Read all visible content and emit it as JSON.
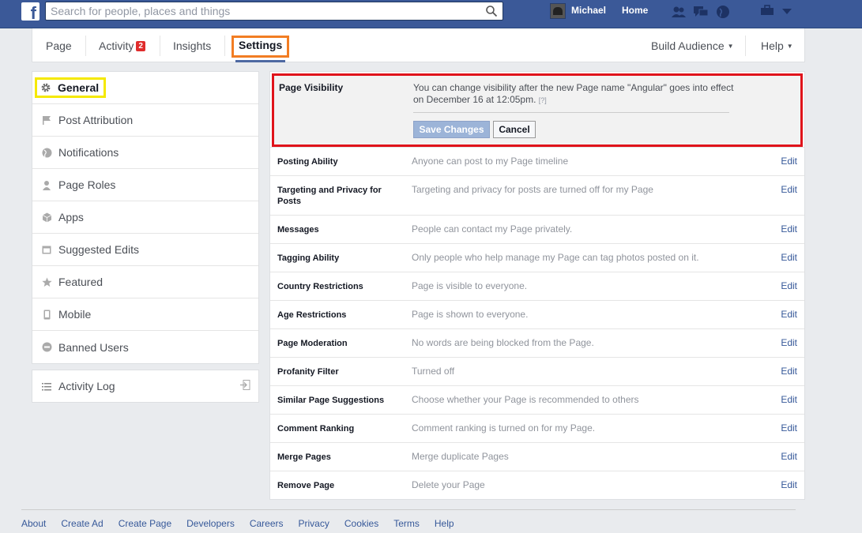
{
  "topbar": {
    "logo": "f",
    "search_placeholder": "Search for people, places and things",
    "user_name": "Michael",
    "home_label": "Home",
    "icons": [
      "friend-requests-icon",
      "messages-icon",
      "notifications-globe-icon",
      "privacy-shortcuts-icon",
      "account-caret-icon"
    ]
  },
  "pagenav": {
    "tabs": [
      {
        "label": "Page"
      },
      {
        "label": "Activity",
        "badge": "2"
      },
      {
        "label": "Insights"
      },
      {
        "label": "Settings",
        "active": true
      }
    ],
    "build_audience": "Build Audience",
    "help": "Help"
  },
  "sidebar": {
    "items": [
      {
        "label": "General",
        "icon": "gear-icon",
        "active": true
      },
      {
        "label": "Post Attribution",
        "icon": "flag-icon"
      },
      {
        "label": "Notifications",
        "icon": "globe-icon"
      },
      {
        "label": "Page Roles",
        "icon": "person-icon"
      },
      {
        "label": "Apps",
        "icon": "cube-icon"
      },
      {
        "label": "Suggested Edits",
        "icon": "calendar-icon"
      },
      {
        "label": "Featured",
        "icon": "star-icon"
      },
      {
        "label": "Mobile",
        "icon": "phone-icon"
      },
      {
        "label": "Banned Users",
        "icon": "banned-icon"
      }
    ],
    "activity_log": "Activity Log"
  },
  "visibility": {
    "label": "Page Visibility",
    "text": "You can change visibility after the new Page name \"Angular\" goes into effect on December 16 at 12:05pm.",
    "help": "[?]",
    "save": "Save Changes",
    "cancel": "Cancel"
  },
  "settings_rows": [
    {
      "label": "Posting Ability",
      "value": "Anyone can post to my Page timeline",
      "edit": "Edit"
    },
    {
      "label": "Targeting and Privacy for Posts",
      "value": "Targeting and privacy for posts are turned off for my Page",
      "edit": "Edit"
    },
    {
      "label": "Messages",
      "value": "People can contact my Page privately.",
      "edit": "Edit"
    },
    {
      "label": "Tagging Ability",
      "value": "Only people who help manage my Page can tag photos posted on it.",
      "edit": "Edit"
    },
    {
      "label": "Country Restrictions",
      "value": "Page is visible to everyone.",
      "edit": "Edit"
    },
    {
      "label": "Age Restrictions",
      "value": "Page is shown to everyone.",
      "edit": "Edit"
    },
    {
      "label": "Page Moderation",
      "value": "No words are being blocked from the Page.",
      "edit": "Edit"
    },
    {
      "label": "Profanity Filter",
      "value": "Turned off",
      "edit": "Edit"
    },
    {
      "label": "Similar Page Suggestions",
      "value": "Choose whether your Page is recommended to others",
      "edit": "Edit"
    },
    {
      "label": "Comment Ranking",
      "value": "Comment ranking is turned on for my Page.",
      "edit": "Edit"
    },
    {
      "label": "Merge Pages",
      "value": "Merge duplicate Pages",
      "edit": "Edit"
    },
    {
      "label": "Remove Page",
      "value": "Delete your Page",
      "edit": "Edit"
    }
  ],
  "footer": [
    "About",
    "Create Ad",
    "Create Page",
    "Developers",
    "Careers",
    "Privacy",
    "Cookies",
    "Terms",
    "Help"
  ],
  "colors": {
    "brand": "#3b5998",
    "highlight_red": "#e0131b",
    "highlight_orange": "#f27d23",
    "highlight_yellow": "#f5e900"
  }
}
